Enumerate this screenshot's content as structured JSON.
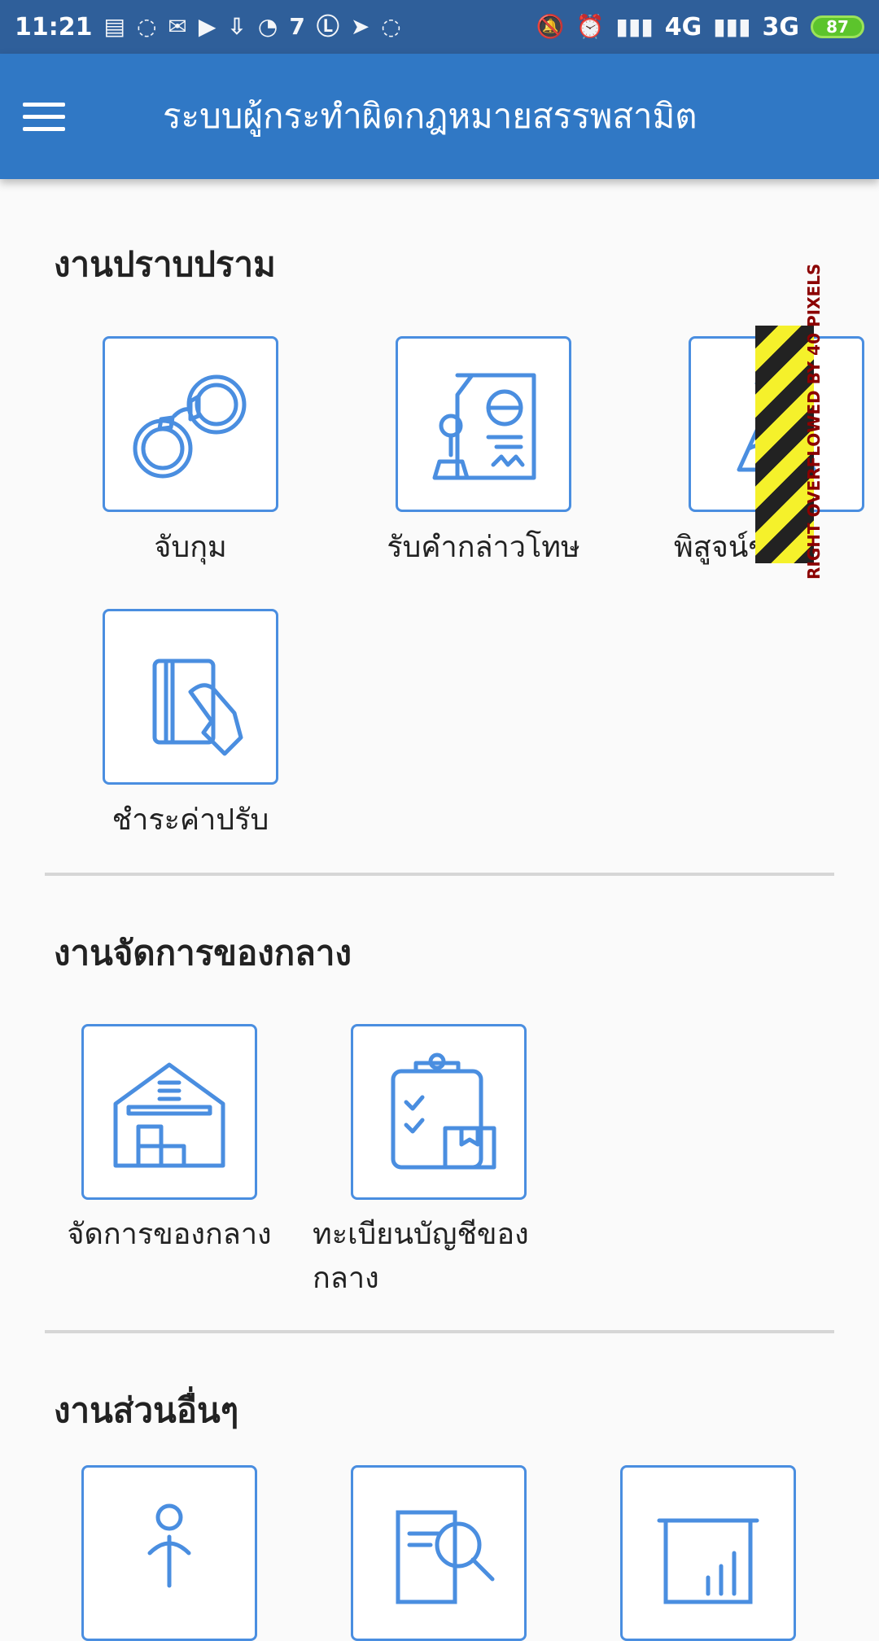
{
  "status_bar": {
    "time": "11:21",
    "signal_1": "4G",
    "signal_2": "3G",
    "battery": "87"
  },
  "appbar": {
    "title": "ระบบผู้กระทำผิดกฎหมายสรรพสามิต"
  },
  "sections": [
    {
      "title": "งานปราบปราม",
      "items": [
        {
          "label": "จับกุม",
          "icon": "handcuffs-icon"
        },
        {
          "label": "รับคำกล่าวโทษ",
          "icon": "document-stamp-icon"
        },
        {
          "label": "พิสูจน์ของ",
          "icon": "flask-icon"
        },
        {
          "label": "ชำระค่าปรับ",
          "icon": "card-payment-icon"
        }
      ]
    },
    {
      "title": "งานจัดการของกลาง",
      "items": [
        {
          "label": "จัดการของกลาง",
          "icon": "warehouse-icon"
        },
        {
          "label": "ทะเบียนบัญชีของกลาง",
          "icon": "clipboard-box-icon"
        }
      ]
    },
    {
      "title": "งานส่วนอื่นๆ",
      "items": [
        {
          "icon": "person-icon"
        },
        {
          "icon": "document-search-icon"
        },
        {
          "icon": "presentation-chart-icon"
        }
      ]
    }
  ],
  "overflow_warning": "RIGHT OVERFLOWED BY 40 PIXELS",
  "colors": {
    "appbar": "#3078c5",
    "statusbar": "#2f5f9a",
    "icon": "#4a8ee0"
  }
}
